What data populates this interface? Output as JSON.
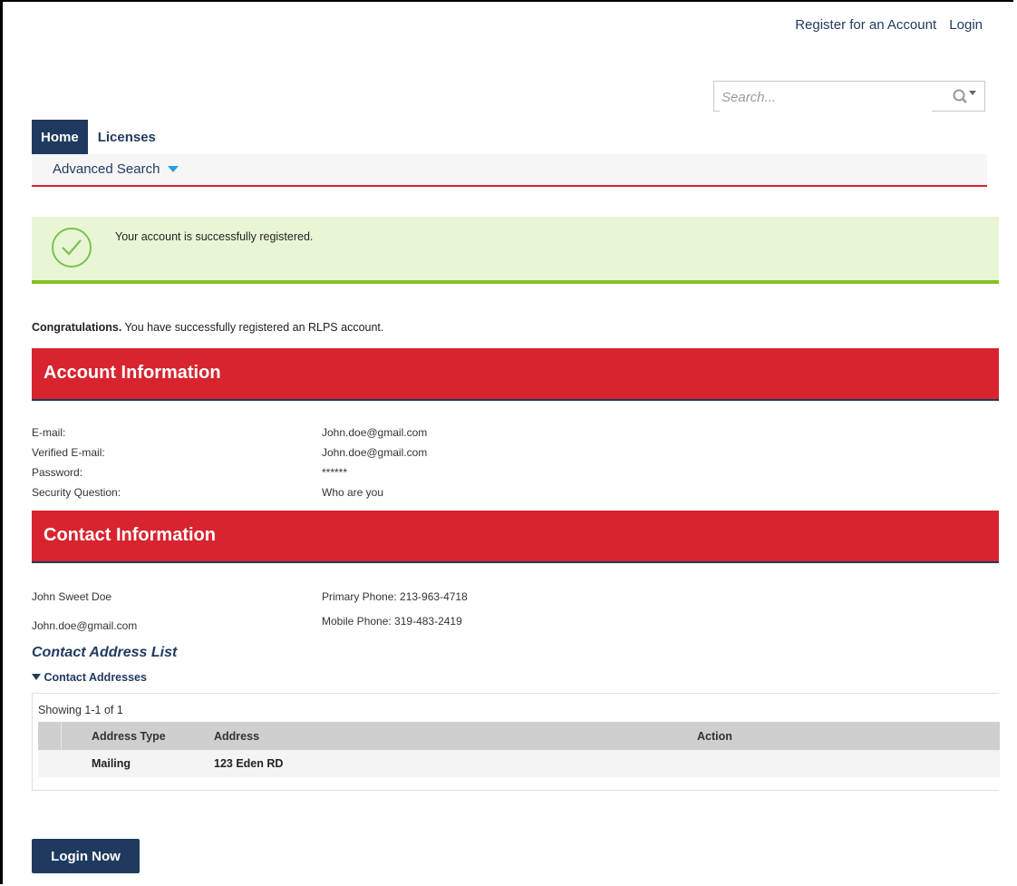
{
  "top_links": {
    "register": "Register for an Account",
    "login": "Login"
  },
  "search": {
    "placeholder": "Search..."
  },
  "tabs": [
    {
      "label": "Home",
      "active": true
    },
    {
      "label": "Licenses",
      "active": false
    }
  ],
  "subnav": {
    "advanced_search": "Advanced Search"
  },
  "success": {
    "message": "Your account is successfully registered."
  },
  "congrats": {
    "bold": "Congratulations.",
    "text": " You have successfully registered an RLPS account."
  },
  "account_info": {
    "title": "Account Information",
    "rows": [
      {
        "label": "E-mail:",
        "value": "John.doe@gmail.com"
      },
      {
        "label": "Verified E-mail:",
        "value": "John.doe@gmail.com"
      },
      {
        "label": "Password:",
        "value": "******"
      },
      {
        "label": "Security Question:",
        "value": "Who are you"
      }
    ]
  },
  "contact_info": {
    "title": "Contact Information",
    "name": "John Sweet Doe",
    "email": "John.doe@gmail.com",
    "primary_phone": "Primary Phone:  213-963-4718",
    "mobile_phone": "Mobile Phone:  319-483-2419"
  },
  "address_list": {
    "title": "Contact Address List",
    "toggle": "Contact Addresses",
    "showing": "Showing 1-1 of 1",
    "headers": [
      "Address Type",
      "Address",
      "Action"
    ],
    "rows": [
      {
        "type": "Mailing",
        "address": "123 Eden RD",
        "action": ""
      }
    ]
  },
  "login_button": "Login Now",
  "colors": {
    "navy": "#1f3a5f",
    "red": "#d7242f",
    "green": "#82c123",
    "success_bg": "#e9f6d6"
  }
}
